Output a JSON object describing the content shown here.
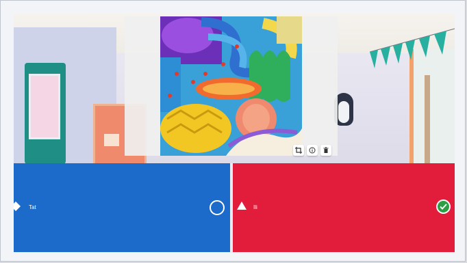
{
  "answers": [
    {
      "text": "Tat",
      "shape": "diamond-icon",
      "color": "#1c6ac9",
      "correct": false
    },
    {
      "text": "Ili",
      "shape": "triangle-icon",
      "color": "#e21d3c",
      "correct": true
    }
  ],
  "image_tools": [
    "crop-icon",
    "info-icon",
    "delete-icon"
  ],
  "colors": {
    "answer_blue": "#1c6ac9",
    "answer_red": "#e21d3c",
    "correct_green": "#2e9e44"
  }
}
